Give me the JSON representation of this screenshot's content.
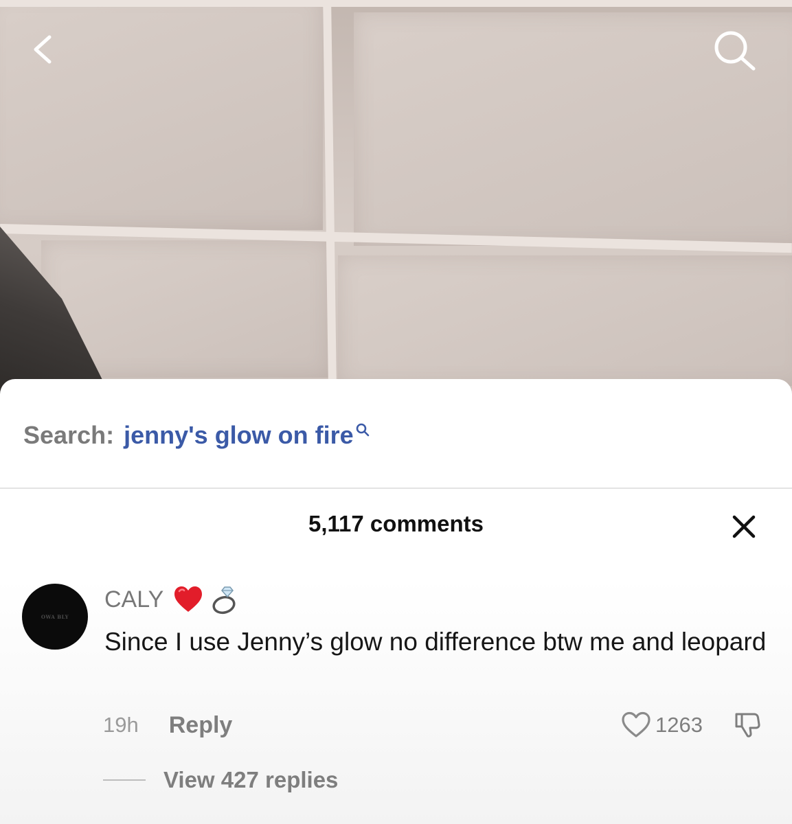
{
  "video": {
    "back_icon": "chevron-left-icon",
    "search_icon": "search-icon"
  },
  "search": {
    "label": "Search:",
    "term": "jenny's glow on fire",
    "icon": "small-search-icon",
    "term_color": "#3b5aa7"
  },
  "comments": {
    "count_label": "5,117 comments",
    "close_icon": "close-icon"
  },
  "comment": {
    "avatar_text": "OWA BLY",
    "username": "CALY",
    "emojis": [
      "red-heart-emoji",
      "ring-emoji"
    ],
    "text": "Since I use Jenny’s glow no difference btw me and leopard",
    "time": "19h",
    "reply_label": "Reply",
    "like_count": "1263",
    "view_replies_label": "View 427 replies"
  }
}
